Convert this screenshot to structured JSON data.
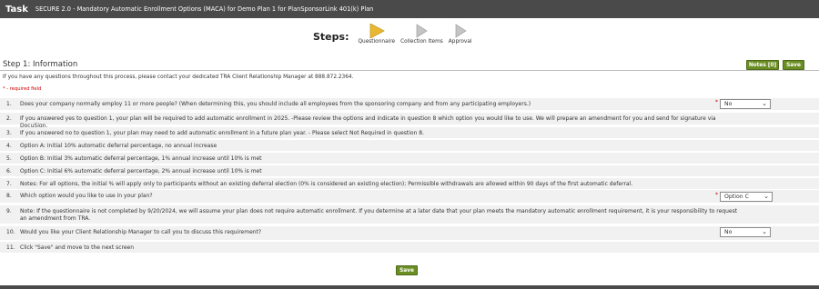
{
  "header": {
    "task_label": "Task",
    "title": "SECURE 2.0 - Mandatory Automatic Enrollment Options (MACA) for Demo Plan 1 for PlanSponsorLink 401(k) Plan"
  },
  "steps": {
    "label": "Steps:",
    "items": [
      {
        "label": "Questionnaire",
        "color": "#e8b830"
      },
      {
        "label": "Collection Items",
        "color": "#bdbdbd"
      },
      {
        "label": "Approval",
        "color": "#bdbdbd"
      }
    ]
  },
  "section": {
    "title": "Step 1: Information",
    "notes_label": "Notes [0]",
    "save_label": "Save",
    "info": "If you have any questions throughout this process, please contact your dedicated TRA Client Relationship Manager at 888.872.2364.",
    "required_note": "* - required field"
  },
  "questions": [
    {
      "num": "1.",
      "text": "Does your company normally employ 11 or more people? (When determining this, you should include all employees from the sponsoring company and from any participating employers.)",
      "required": "*",
      "value": "No"
    },
    {
      "num": "2.",
      "text": "If you answered yes to question 1, your plan will be required to add automatic enrollment in 2025. -Please review the options and indicate in question 8 which option you would like to use. We will prepare an amendment for you and send for signature via DocuSign."
    },
    {
      "num": "3.",
      "text": "If you answered no to question 1, your plan may need to add automatic enrollment in a future plan year. - Please select Not Required in question 8."
    },
    {
      "num": "4.",
      "text": "Option A: Initial 10% automatic deferral percentage, no annual increase"
    },
    {
      "num": "5.",
      "text": "Option B: Initial 3% automatic deferral percentage, 1% annual increase until 10% is met"
    },
    {
      "num": "6.",
      "text": "Option C: Initial 6% automatic deferral percentage, 2% annual increase until 10% is met"
    },
    {
      "num": "7.",
      "text": "Notes: For all options, the initial % will apply only to participants without an existing deferral election (0% is considered an existing election); Permissible withdrawals are allowed within 90 days of the first automatic deferral."
    },
    {
      "num": "8.",
      "text": "Which option would you like to use in your plan?",
      "required": "*",
      "value": "Option C"
    },
    {
      "num": "9.",
      "text": "Note: If the questionnaire is not completed by 9/20/2024, we will assume your plan does not require automatic enrollment. If you determine at a later date that your plan meets the mandatory automatic enrollment requirement, it is your responsibility to request an amendment from TRA."
    },
    {
      "num": "10.",
      "text": "Would you like your Client Relationship Manager to call you to discuss this requirement?",
      "value": "No"
    },
    {
      "num": "11.",
      "text": "Click \"Save\" and move to the next screen"
    }
  ],
  "footer": {
    "save_label": "Save"
  }
}
